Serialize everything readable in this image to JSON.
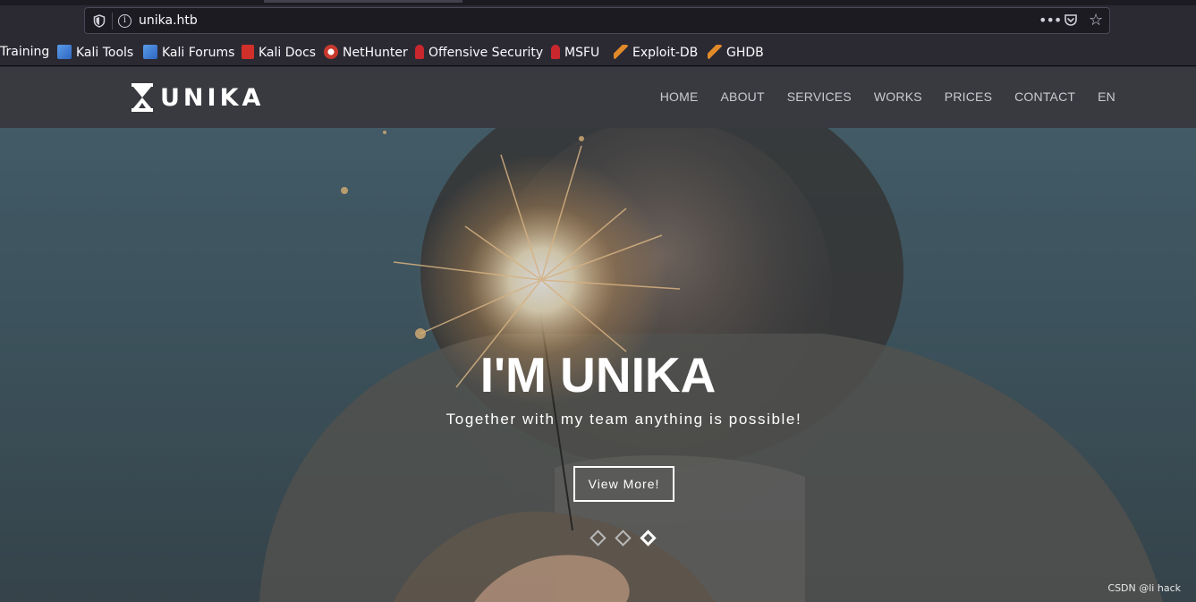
{
  "browser": {
    "url": "unika.htb",
    "bookmarks": [
      {
        "label": "Training",
        "icon": "none"
      },
      {
        "label": "Kali Tools",
        "icon": "kali-icon",
        "color": "#3b7bd6"
      },
      {
        "label": "Kali Forums",
        "icon": "kali-icon",
        "color": "#3b7bd6"
      },
      {
        "label": "Kali Docs",
        "icon": "kali-docs-icon",
        "color": "#d1302a"
      },
      {
        "label": "NetHunter",
        "icon": "nethunter-icon",
        "color": "#c7392d"
      },
      {
        "label": "Offensive Security",
        "icon": "offsec-icon",
        "color": "#c8282d"
      },
      {
        "label": "MSFU",
        "icon": "offsec-icon",
        "color": "#c8282d"
      },
      {
        "label": "Exploit-DB",
        "icon": "exploitdb-icon",
        "color": "#e08a2a"
      },
      {
        "label": "GHDB",
        "icon": "exploitdb-icon",
        "color": "#e08a2a"
      }
    ]
  },
  "site": {
    "logo_text": "UNIKA",
    "nav": [
      "HOME",
      "ABOUT",
      "SERVICES",
      "WORKS",
      "PRICES",
      "CONTACT",
      "EN"
    ],
    "hero": {
      "title": "I'M UNIKA",
      "subtitle": "Together with my team anything is possible!",
      "button_label": "View More!",
      "slides": 3,
      "active_slide": 3
    }
  },
  "watermark": "CSDN @li hack"
}
